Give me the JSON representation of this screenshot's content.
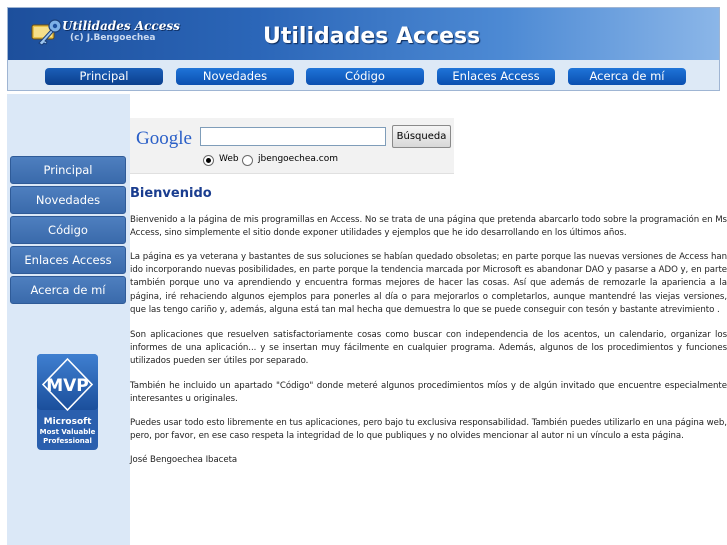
{
  "header": {
    "logo_name": "Utilidades Access",
    "logo_copyright": "(c) J.Bengoechea",
    "site_title": "Utilidades Access"
  },
  "top_nav": [
    {
      "label": "Principal",
      "active": true
    },
    {
      "label": "Novedades",
      "active": false
    },
    {
      "label": "Código",
      "active": false
    },
    {
      "label": "Enlaces Access",
      "active": false
    },
    {
      "label": "Acerca de mí",
      "active": false
    }
  ],
  "side_nav": [
    {
      "label": "Principal"
    },
    {
      "label": "Novedades"
    },
    {
      "label": "Código"
    },
    {
      "label": "Enlaces Access"
    },
    {
      "label": "Acerca de mí"
    }
  ],
  "mvp_badge": {
    "abbr": "MVP",
    "line1": "Microsoft",
    "line2": "Most Valuable",
    "line3": "Professional"
  },
  "search": {
    "logo_text": "Google",
    "input_value": "",
    "button_label": "Búsqueda",
    "option_web": "Web",
    "option_site": "jbengoechea.com",
    "selected": "web"
  },
  "content": {
    "heading": "Bienvenido",
    "paragraphs": [
      "Bienvenido a la página de mis programillas en Access. No se trata de una página que pretenda abarcarlo todo sobre la programación en Ms Access, sino simplemente el sitio donde exponer utilidades y ejemplos que he ido desarrollando en los últimos años.",
      "La página es ya veterana y bastantes de sus soluciones se habían quedado obsoletas; en parte porque las nuevas versiones de Access han ido incorporando nuevas posibilidades, en parte porque la tendencia marcada por Microsoft es abandonar DAO y pasarse a ADO y, en parte también porque uno va aprendiendo y encuentra formas mejores de hacer las cosas. Así que además de remozarle la apariencia a la página, iré rehaciendo algunos ejemplos para ponerles al día o para mejorarlos o completarlos, aunque mantendré las viejas versiones, que las tengo cariño y, además, alguna está tan mal hecha que demuestra lo que se puede conseguir con tesón y bastante atrevimiento .",
      "Son aplicaciones que resuelven satisfactoriamente cosas como buscar con independencia de los acentos, un calendario, organizar los informes de una aplicación... y se insertan muy fácilmente en cualquier programa. Además, algunos de los procedimientos y funciones utilizados pueden ser útiles por separado.",
      "También he incluido un apartado \"Código\" donde meteré algunos procedimientos míos y de algún invitado que encuentre especialmente interesantes u originales.",
      "Puedes usar todo esto libremente en tus aplicaciones, pero bajo tu exclusiva responsabilidad. También puedes utilizarlo en una página web, pero, por favor, en ese caso respeta la integridad de lo que publiques y no olvides mencionar al autor ni un vínculo a esta página.",
      "José Bengoechea Ibaceta"
    ]
  },
  "colors": {
    "header_dark": "#1d4f9c",
    "header_light": "#8bb6e8",
    "nav_button": "#0a4fb0",
    "sidebar_bg": "#dbe8f7",
    "side_button": "#4e7fbf",
    "heading": "#1a3d8f"
  }
}
